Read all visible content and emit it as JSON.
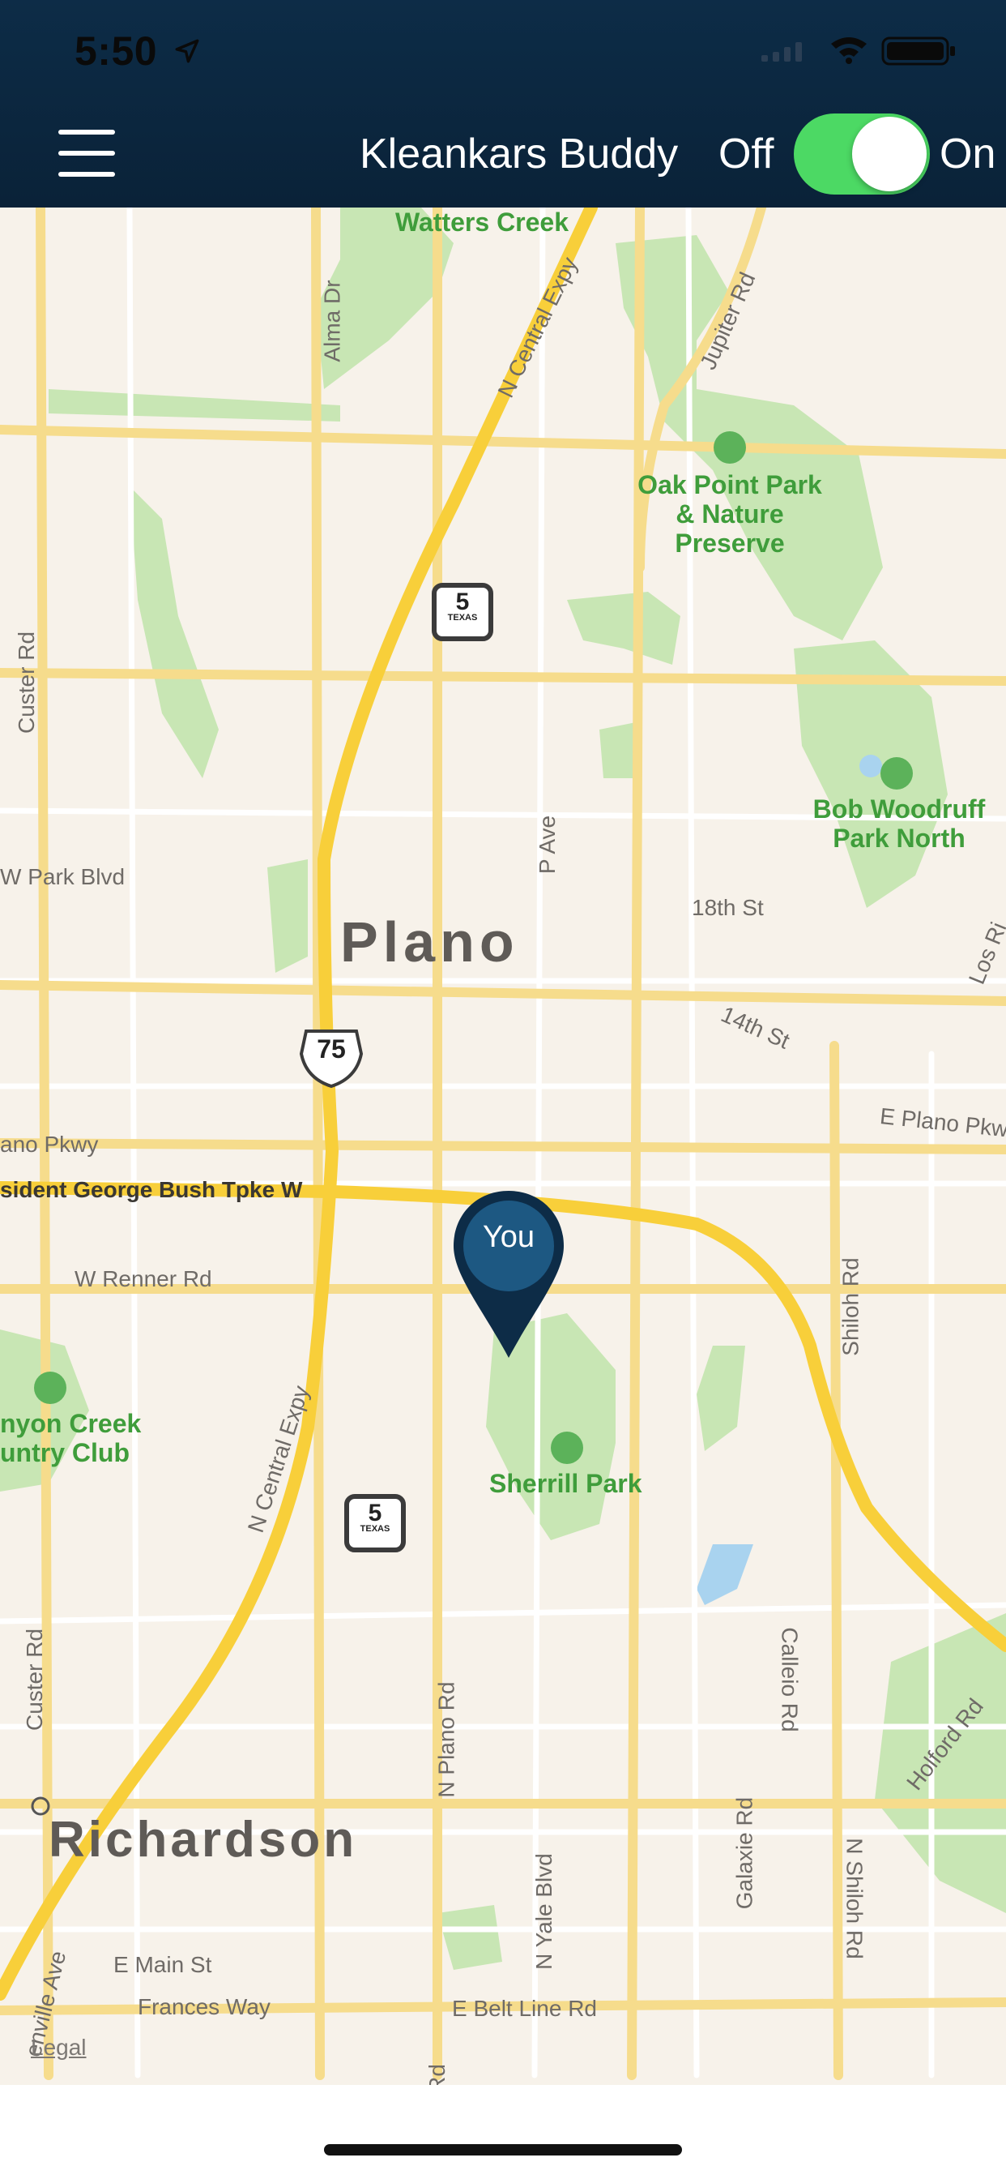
{
  "status_bar": {
    "time": "5:50"
  },
  "header": {
    "title": "Kleankars Buddy",
    "off_label": "Off",
    "on_label": "On",
    "toggle_state": "on",
    "bg_color": "#0b2540",
    "toggle_color": "#4cd964"
  },
  "map": {
    "city_labels": [
      "Plano",
      "Richardson"
    ],
    "park_labels": [
      "Watters Creek",
      "Oak Point Park & Nature Preserve",
      "Bob Woodruff Park North",
      "Sherrill Park",
      "nyon Creek untry Club"
    ],
    "road_labels": [
      "Alma Dr",
      "N Central Expy",
      "Jupiter Rd",
      "Custer Rd",
      "W Park Blvd",
      "P Ave",
      "18th St",
      "14th St",
      "Los Ri",
      "ano Pkwy",
      "E Plano Pkwy",
      "sident George Bush Tpke W",
      "W Renner Rd",
      "Shiloh Rd",
      "N Central Expy",
      "Custer Rd",
      "N Plano Rd",
      "Calleio Rd",
      "Holford Rd",
      "Galaxie Rd",
      "N Yale Blvd",
      "N Shiloh Rd",
      "E Main St",
      "Frances Way",
      "E Belt Line Rd",
      "enville Ave",
      "Rd"
    ],
    "shields": [
      "5",
      "75",
      "5"
    ],
    "shield_caption": "TEXAS",
    "pin_label": "You",
    "legal_label": "Legal",
    "pin_color": "#0d2c47"
  }
}
